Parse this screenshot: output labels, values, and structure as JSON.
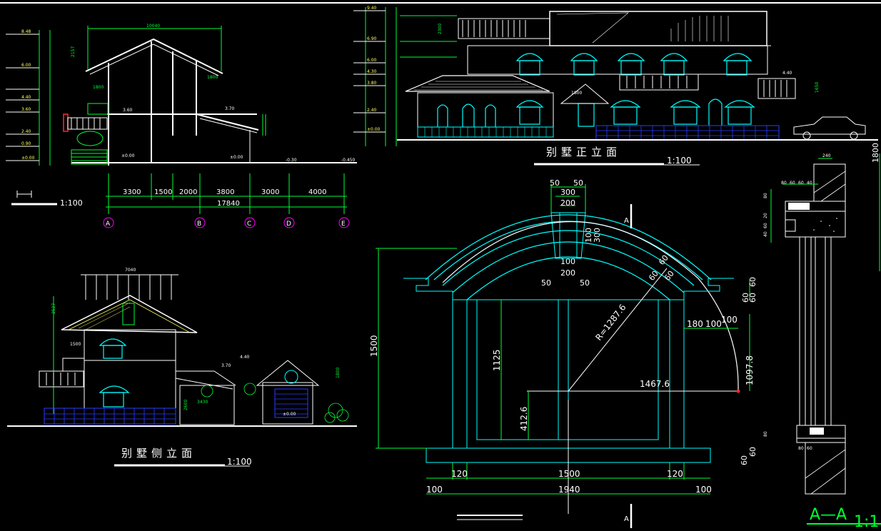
{
  "drawing": {
    "colors": {
      "line": "#ffffff",
      "dim": "#00ff33",
      "cyan": "#00ffff",
      "blue": "#2a3cff",
      "red": "#ff2a2a",
      "magenta": "#ff00ff",
      "background": "#000000"
    },
    "section": {
      "scale": "1:100",
      "levels": [
        "8.48",
        "6.00",
        "4.40",
        "3.60",
        "2.40",
        "0.90",
        "±0.00"
      ],
      "overall_width": "10040",
      "dims_top": [
        "2157",
        "1800",
        "1800"
      ],
      "inner_levels": [
        "3.60",
        "3.70",
        "±0.00",
        "-0.30",
        "-0.450"
      ],
      "widths": [
        "3300",
        "1500",
        "2000",
        "3800",
        "3000",
        "4000"
      ],
      "total": "17840",
      "axes": [
        "A",
        "B",
        "C",
        "D",
        "E"
      ]
    },
    "front": {
      "title": "别墅正立面",
      "scale": "1:100",
      "levels": [
        "9.40",
        "6.90",
        "6.00",
        "4.30",
        "3.80",
        "2.40",
        "±0.00"
      ],
      "dims": [
        "2300",
        "1800",
        "1800",
        "3240",
        "4.40",
        "1650",
        "900",
        "1800"
      ]
    },
    "side": {
      "title": "别墅侧立面",
      "scale": "1:100",
      "dims": [
        "7040",
        "2527",
        "1500",
        "4.40",
        "1800",
        "3.70",
        "±0.00",
        "2600",
        "3430"
      ]
    },
    "arch": {
      "dims_top": [
        "50",
        "50",
        "300",
        "200",
        "100",
        "200",
        "50",
        "50"
      ],
      "dims_right": [
        "60",
        "60",
        "60",
        "180",
        "100",
        "100",
        "1097.8"
      ],
      "radius": "R=1287.6",
      "span": "1467.6",
      "height_total": "1500",
      "inner": [
        "1125",
        "412.6"
      ],
      "dims_bottom": [
        "120",
        "1500",
        "120",
        "1940",
        "100",
        "100",
        "60",
        "60"
      ],
      "section_mark": "A"
    },
    "detail": {
      "title": "A—A",
      "scale": "1:1",
      "dims": [
        "240",
        "80",
        "60",
        "60",
        "40",
        "80",
        "20",
        "60",
        "40",
        "80",
        "80",
        "60"
      ],
      "side_dim": "1800"
    }
  }
}
